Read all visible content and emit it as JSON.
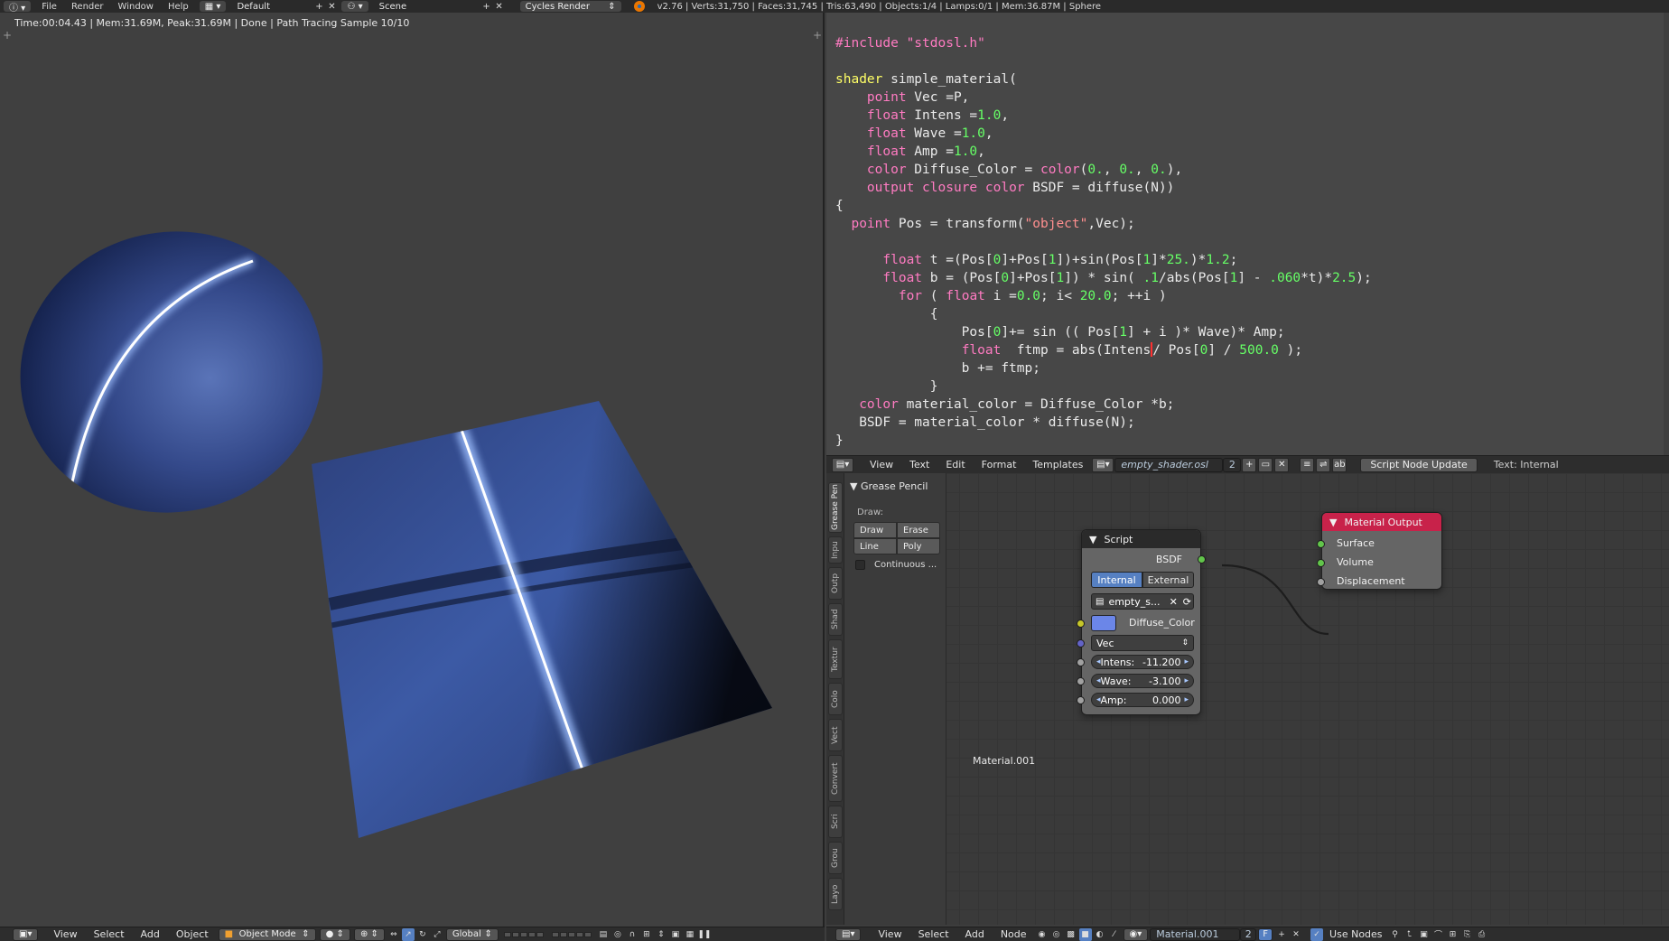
{
  "topbar": {
    "menus": [
      "File",
      "Render",
      "Window",
      "Help"
    ],
    "screen_layout": "Default",
    "scene": "Scene",
    "render_engine": "Cycles Render",
    "stats": "v2.76 | Verts:31,750 | Faces:31,745 | Tris:63,490 | Objects:1/4 | Lamps:0/1 | Mem:36.87M | Sphere"
  },
  "viewport": {
    "status": "Time:00:04.43 | Mem:31.69M, Peak:31.69M | Done | Path Tracing Sample 10/10"
  },
  "code_lines": [
    "#include \"stdosl.h\"",
    "",
    "shader simple_material(",
    "    point Vec =P,",
    "    float Intens =1.0,",
    "    float Wave =1.0,",
    "    float Amp =1.0,",
    "    color Diffuse_Color = color(0., 0., 0.),",
    "    output closure color BSDF = diffuse(N))",
    "{",
    "  point Pos = transform(\"object\",Vec);",
    "",
    "      float t =(Pos[0]+Pos[1])+sin(Pos[1]*25.)*1.2;",
    "      float b = (Pos[0]+Pos[1]) * sin( .1/abs(Pos[1] - .060*t)*2.5);",
    "        for ( float i =0.0; i< 20.0; ++i )",
    "            {",
    "                Pos[0]+= sin (( Pos[1] + i )* Wave)* Amp;",
    "                float  ftmp = abs(Intens/ Pos[0] / 500.0 );",
    "                b += ftmp;",
    "            }",
    "   color material_color = Diffuse_Color *b;",
    "   BSDF = material_color * diffuse(N);",
    "}"
  ],
  "text_header": {
    "menus": [
      "View",
      "Text",
      "Format",
      "Templates"
    ],
    "file_name": "empty_shader.osl",
    "users": "2",
    "script_button": "Script Node Update",
    "text_source": "Text: Internal"
  },
  "tool_shelf": {
    "tabs": [
      "Grease Pen",
      "Inpu",
      "Outp",
      "Shad",
      "Textur",
      "Colo",
      "Vect",
      "Convert",
      "Scri",
      "Grou",
      "Layo"
    ],
    "panel_title": "Grease Pencil",
    "draw_label": "Draw:",
    "buttons": {
      "draw": "Draw",
      "erase": "Erase",
      "line": "Line",
      "poly": "Poly"
    },
    "continuous": "Continuous ..."
  },
  "script_node": {
    "title": "Script",
    "output": "BSDF",
    "mode_internal": "Internal",
    "mode_external": "External",
    "script_name": "empty_s...",
    "color_label": "Diffuse_Color",
    "color_value": "#6b86e8",
    "vec_label": "Vec",
    "intens_label": "Intens:",
    "intens_value": "-11.200",
    "wave_label": "Wave:",
    "wave_value": "-3.100",
    "amp_label": "Amp:",
    "amp_value": "0.000"
  },
  "output_node": {
    "title": "Material Output",
    "inputs": [
      "Surface",
      "Volume",
      "Displacement"
    ]
  },
  "node_material_label": "Material.001",
  "bottom_left": {
    "menus": [
      "View",
      "Select",
      "Add",
      "Object"
    ],
    "mode": "Object Mode",
    "orientation": "Global"
  },
  "bottom_right": {
    "menus": [
      "View",
      "Select",
      "Add",
      "Node"
    ],
    "material": "Material.001",
    "users": "2",
    "fake_user": "F",
    "use_nodes": "Use Nodes"
  },
  "colors": {
    "accent_blue": "#5680c2",
    "output_header": "#c8224a",
    "script_header": "#2a2a2a",
    "socket_green": "#62c54b",
    "socket_yellow": "#c7c729",
    "socket_blue": "#6363c7",
    "socket_grey": "#a1a1a1"
  }
}
